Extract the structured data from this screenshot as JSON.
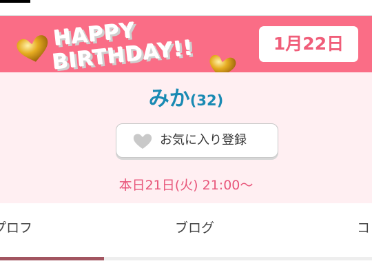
{
  "banner": {
    "line1": "HAPPY",
    "line2": "BIRTHDAY!!",
    "date": "1月22日",
    "colors": {
      "background": "#fa6d86",
      "date_text": "#f05d79"
    }
  },
  "profile": {
    "name": "みか",
    "age": "(32)",
    "favorite_label": "お気に入り登録",
    "schedule": "本日21日(火) 21:00〜"
  },
  "tabs": [
    {
      "label": "プロフ",
      "active": true
    },
    {
      "label": "ブログ",
      "active": false
    },
    {
      "label": "コ",
      "active": false
    }
  ],
  "icons": [
    "gold-heart-icon",
    "heart-icon"
  ]
}
